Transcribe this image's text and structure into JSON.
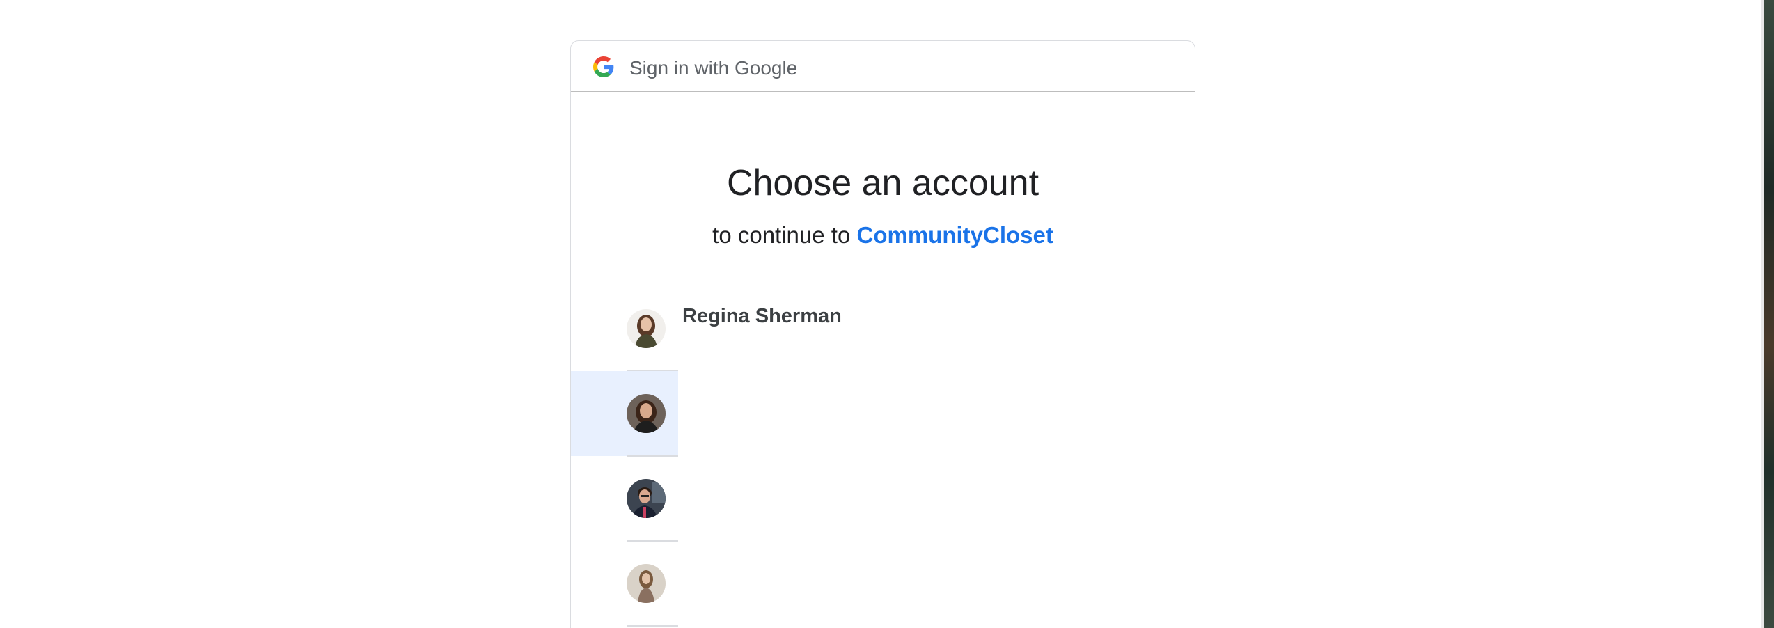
{
  "header": {
    "title": "Sign in with Google",
    "logo_icon": "google-g-icon"
  },
  "main": {
    "heading": "Choose an account",
    "subheading_prefix": "to continue to",
    "app_name": "CommunityCloset"
  },
  "accounts": [
    {
      "name": "Regina Sherman",
      "avatar_icon": "avatar-woman-1",
      "highlighted": false
    },
    {
      "name": "",
      "avatar_icon": "avatar-woman-2",
      "highlighted": true
    },
    {
      "name": "",
      "avatar_icon": "avatar-man-1",
      "highlighted": false
    },
    {
      "name": "",
      "avatar_icon": "avatar-woman-3",
      "highlighted": false
    }
  ],
  "colors": {
    "link": "#1a73e8",
    "highlight": "#e8f0fe",
    "text_primary": "#202124",
    "text_secondary": "#5f6368",
    "border": "#dadce0"
  }
}
